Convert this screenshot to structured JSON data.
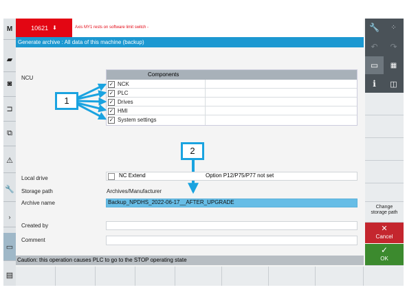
{
  "alarm": {
    "number": "10621",
    "text": "Axis MY1 rests on software limit switch -"
  },
  "dialog": {
    "title": "Generate archive : All data of this machine (backup)"
  },
  "ncu": {
    "label": "NCU"
  },
  "components": {
    "header": "Components",
    "items": [
      {
        "label": "NCK",
        "checked": "✓"
      },
      {
        "label": "PLC",
        "checked": "✓"
      },
      {
        "label": "Drives",
        "checked": "✓"
      },
      {
        "label": "HMI",
        "checked": "✓"
      },
      {
        "label": "System settings",
        "checked": "✓"
      }
    ]
  },
  "callouts": {
    "one": "1",
    "two": "2"
  },
  "local_drive": {
    "label": "Local drive",
    "option": "NC Extend",
    "note": "Option P12/P75/P77 not set"
  },
  "storage_path": {
    "label": "Storage path",
    "value": "Archives/Manufacturer"
  },
  "archive_name": {
    "label": "Archive name",
    "value": "Backup_NPDHS_2022-06-17__AFTER_UPGRADE"
  },
  "created_by": {
    "label": "Created by",
    "value": ""
  },
  "comment": {
    "label": "Comment",
    "value": ""
  },
  "status": {
    "text": "Caution: this operation causes PLC to go to the STOP operating state"
  },
  "softkeys": {
    "change_storage_path": "Change storage path",
    "cancel": "Cancel",
    "ok": "OK"
  },
  "colors": {
    "accent": "#1c98d1",
    "alarm": "#e30613",
    "cancel": "#c4262e",
    "ok": "#3c8a2e",
    "callout": "#1aa3e0"
  }
}
